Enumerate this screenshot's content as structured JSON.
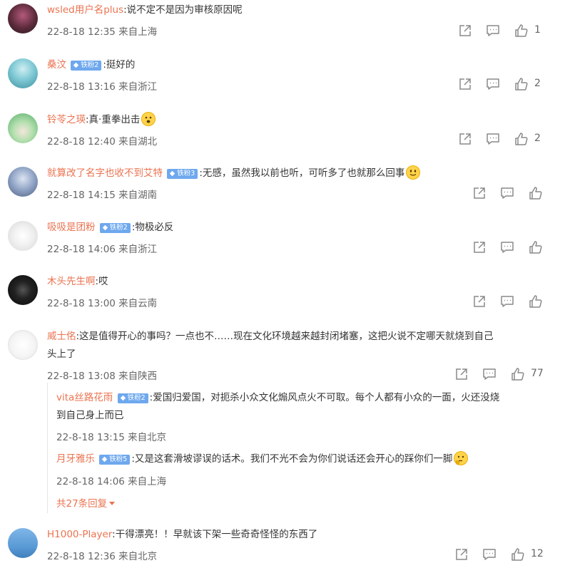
{
  "comments": [
    {
      "user": "wsled用户名plus",
      "badge": "",
      "text": ":说不定不是因为审核原因呢",
      "time": "22-8-18 12:35 来自上海",
      "likes": "1"
    },
    {
      "user": "桑汶",
      "badge": "铁粉2",
      "text": ":挺好的",
      "time": "22-8-18 13:16 来自浙江",
      "likes": "2"
    },
    {
      "user": "铃苓之瑛",
      "badge": "",
      "text": ":真·重拳出击",
      "time": "22-8-18 12:40 来自湖北",
      "likes": "2"
    },
    {
      "user": "就算改了名字也收不到艾特",
      "badge": "铁粉3",
      "text": ":无感，虽然我以前也听，可听多了也就那么回事",
      "time": "22-8-18 14:15 来自湖南",
      "likes": ""
    },
    {
      "user": "吸吸是团粉",
      "badge": "铁粉2",
      "text": ":物极必反",
      "time": "22-8-18 14:06 来自浙江",
      "likes": ""
    },
    {
      "user": "木头先生啊",
      "badge": "",
      "text": ":哎",
      "time": "22-8-18 13:00 来自云南",
      "likes": ""
    },
    {
      "user": "威士佲",
      "badge": "",
      "text": ":这是值得开心的事吗？一点也不……现在文化环境越来越封闭堵塞，这把火说不定哪天就烧到自己",
      "text2": "头上了",
      "time": "22-8-18 13:08 来自陕西",
      "likes": "77"
    },
    {
      "user": "H1000-Player",
      "badge": "",
      "text": ":干得漂亮！！早就该下架一些奇奇怪怪的东西了",
      "time": "22-8-18 12:36 来自北京",
      "likes": "12"
    }
  ],
  "replies": [
    {
      "user": "vita丝路花雨",
      "badge": "铁粉2",
      "text": ":爱国归爱国，对扼杀小众文化煽风点火不可取。每个人都有小众的一面，火还没烧",
      "text2": "到自己身上而已",
      "time": "22-8-18 13:15 来自北京"
    },
    {
      "user": "月牙雅乐",
      "badge": "铁粉5",
      "text": ":又是这套滑坡谬误的话术。我们不光不会为你们说话还会开心的踩你们一脚",
      "time": "22-8-18 14:06 来自上海"
    }
  ],
  "more_replies": "共27条回复",
  "colors": {
    "username": "#eb7350",
    "badge": "#6ea8ee",
    "meta": "#666666",
    "icon": "#8a8a8a"
  }
}
